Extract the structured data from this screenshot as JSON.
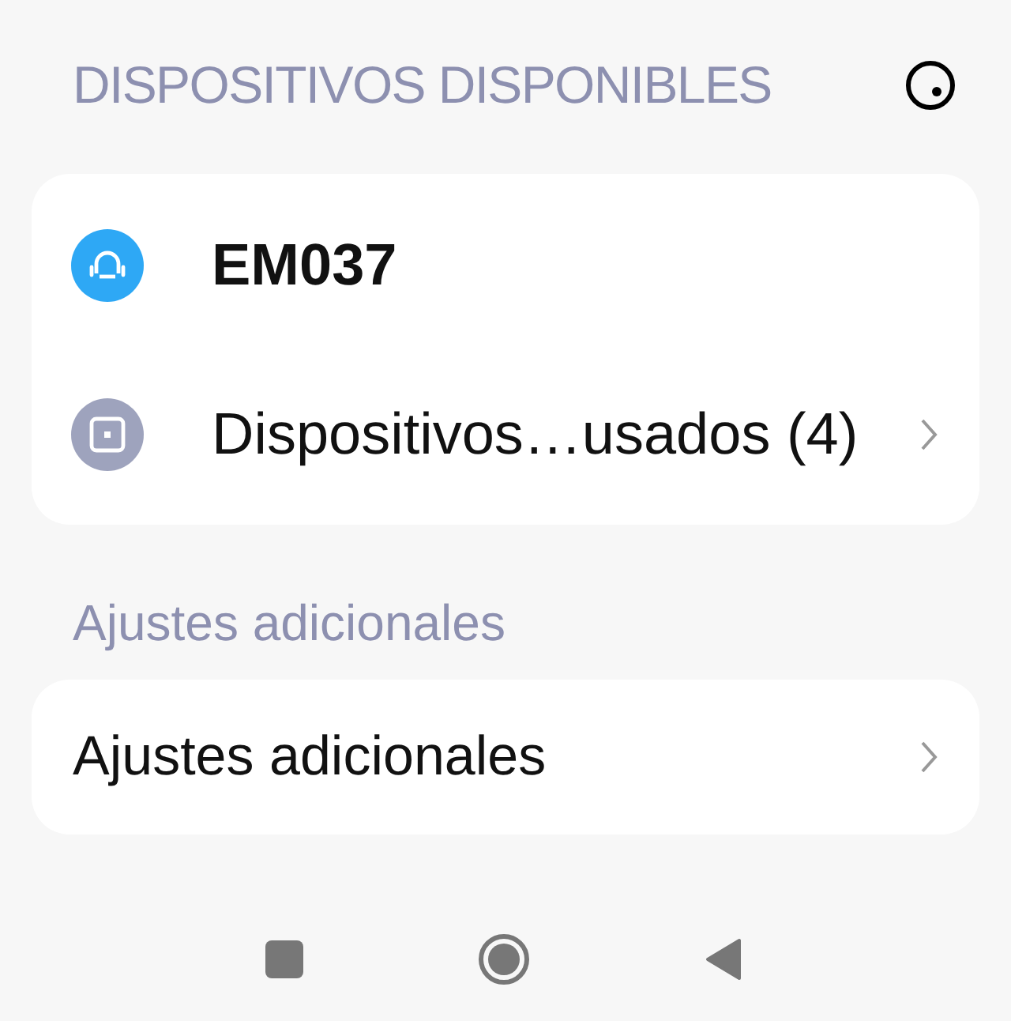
{
  "available_section": {
    "title": "DISPOSITIVOS DISPONIBLES"
  },
  "devices": [
    {
      "kind": "headset",
      "label": "EM037",
      "chevron": false
    },
    {
      "kind": "device",
      "label": "Dispositivos…usados (4)",
      "chevron": true
    }
  ],
  "additional_section": {
    "title": "Ajustes adicionales"
  },
  "additional_items": [
    {
      "label": "Ajustes adicionales",
      "chevron": true
    }
  ]
}
